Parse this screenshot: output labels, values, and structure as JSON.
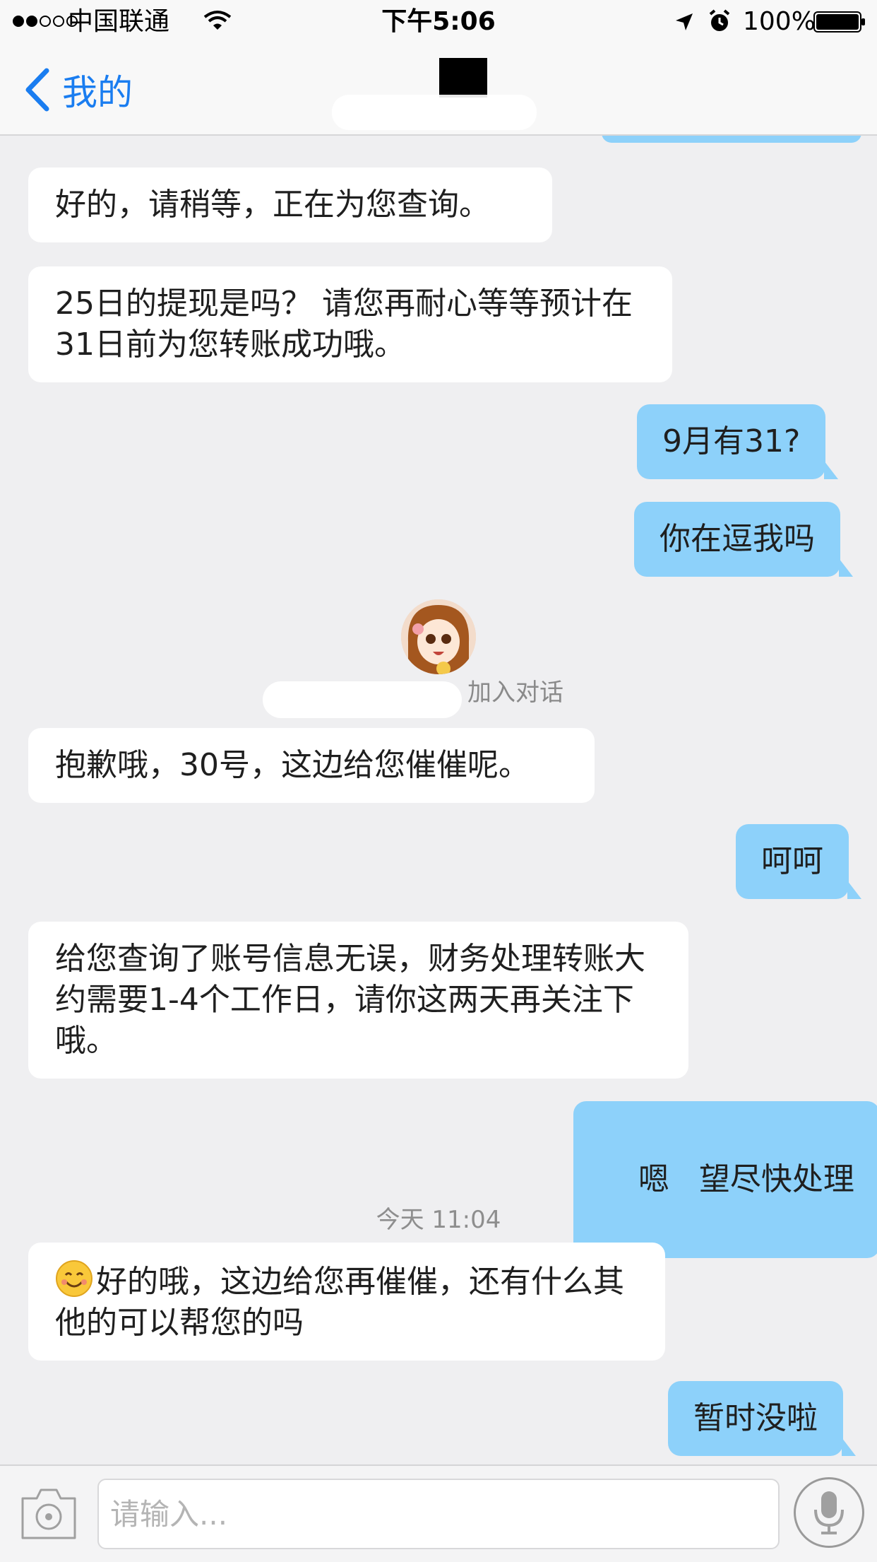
{
  "status_bar": {
    "carrier": "中国联通",
    "time": "下午5:06",
    "battery": "100%",
    "icons": [
      "signal-dots-icon",
      "wifi-icon",
      "location-arrow-icon",
      "alarm-icon",
      "battery-icon"
    ]
  },
  "nav": {
    "back_label": "我的",
    "back_icon": "chevron-left-icon",
    "accent_color": "#1a7df0"
  },
  "messages": [
    {
      "side": "in",
      "text": "好的，请稍等，正在为您查询。"
    },
    {
      "side": "in",
      "text": "25日的提现是吗？ 请您再耐心等等预计在31日前为您转账成功哦。"
    },
    {
      "side": "out",
      "text": "9月有31?"
    },
    {
      "side": "out",
      "text": "你在逗我吗"
    },
    {
      "side": "in",
      "text": "抱歉哦，30号，这边给您催催呢。"
    },
    {
      "side": "out",
      "text": "呵呵"
    },
    {
      "side": "in",
      "text": "给您查询了账号信息无误，财务处理转账大约需要1-4个工作日，请你这两天再关注下哦。"
    },
    {
      "side": "out",
      "text": "嗯   望尽快处理"
    },
    {
      "side": "in",
      "text": "好的哦，这边给您再催催，还有什么其他的可以帮您的吗",
      "emoji": "smiling-face-icon"
    },
    {
      "side": "out",
      "text": "暂时没啦"
    }
  ],
  "system": {
    "join_text": "加入对话",
    "timestamp": "今天 11:04",
    "avatar_icon": "agent-avatar-icon"
  },
  "input_bar": {
    "placeholder": "请输入...",
    "camera_icon": "camera-icon",
    "mic_icon": "microphone-icon"
  },
  "colors": {
    "outgoing_bubble": "#8dd1fa",
    "incoming_bubble": "#ffffff",
    "background": "#efeff1"
  }
}
